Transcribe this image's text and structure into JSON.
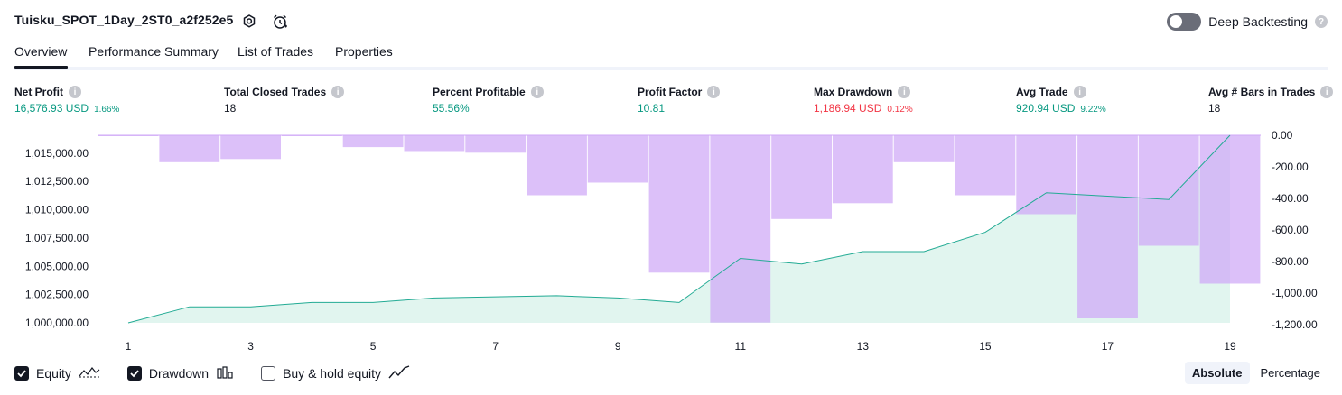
{
  "header": {
    "title": "Tuisku_SPOT_1Day_2ST0_a2f252e5",
    "deep_backtesting_label": "Deep Backtesting",
    "help_mark": "?"
  },
  "tabs": [
    {
      "label": "Overview",
      "active": true
    },
    {
      "label": "Performance Summary",
      "active": false
    },
    {
      "label": "List of Trades",
      "active": false
    },
    {
      "label": "Properties",
      "active": false
    }
  ],
  "metrics": [
    {
      "label": "Net Profit",
      "value": "16,576.93 USD",
      "pct": "1.66%",
      "color": "#089981"
    },
    {
      "label": "Total Closed Trades",
      "value": "18",
      "pct": "",
      "color": "#131722"
    },
    {
      "label": "Percent Profitable",
      "value": "55.56%",
      "pct": "",
      "color": "#089981"
    },
    {
      "label": "Profit Factor",
      "value": "10.81",
      "pct": "",
      "color": "#089981"
    },
    {
      "label": "Max Drawdown",
      "value": "1,186.94 USD",
      "pct": "0.12%",
      "color": "#f23645"
    },
    {
      "label": "Avg Trade",
      "value": "920.94 USD",
      "pct": "9.22%",
      "color": "#089981"
    },
    {
      "label": "Avg # Bars in Trades",
      "value": "18",
      "pct": "",
      "color": "#131722"
    }
  ],
  "info_mark": "i",
  "chart_data": {
    "type": "line",
    "x": [
      1,
      2,
      3,
      4,
      5,
      6,
      7,
      8,
      9,
      10,
      11,
      12,
      13,
      14,
      15,
      16,
      17,
      18,
      19
    ],
    "x_tick_labels": [
      "1",
      "3",
      "5",
      "7",
      "9",
      "11",
      "13",
      "15",
      "17",
      "19"
    ],
    "series": [
      {
        "name": "Equity",
        "axis": "left",
        "type": "area",
        "values": [
          1000000,
          1001420,
          1001420,
          1001800,
          1001800,
          1002200,
          1002300,
          1002400,
          1002200,
          1001800,
          1005700,
          1005200,
          1006300,
          1006300,
          1008000,
          1011500,
          1011200,
          1010900,
          1016577
        ]
      },
      {
        "name": "Drawdown",
        "axis": "right",
        "type": "bar",
        "values": [
          -5,
          -170,
          -150,
          -5,
          -75,
          -100,
          -110,
          -380,
          -300,
          -870,
          -1187,
          -530,
          -430,
          -170,
          -380,
          -500,
          -1160,
          -700,
          -940
        ]
      }
    ],
    "left_axis": {
      "ticks": [
        "1,000,000.00",
        "1,002,500.00",
        "1,005,000.00",
        "1,007,500.00",
        "1,010,000.00",
        "1,012,500.00",
        "1,015,000.00"
      ],
      "min": 1000000,
      "max": 1016577
    },
    "right_axis": {
      "ticks": [
        "0.00",
        "-200.00",
        "-400.00",
        "-600.00",
        "-800.00",
        "-1,000.00",
        "-1,200.00"
      ],
      "min": -1200,
      "max": 0
    },
    "colors": {
      "equity_line": "#22ab94",
      "equity_fill": "#e1f5ef",
      "drawdown": "#cfa8f7"
    }
  },
  "legend": {
    "items": [
      {
        "label": "Equity",
        "checked": true,
        "icon": "equity-icon"
      },
      {
        "label": "Drawdown",
        "checked": true,
        "icon": "drawdown-bars-icon"
      },
      {
        "label": "Buy & hold equity",
        "checked": false,
        "icon": "buy-hold-icon"
      }
    ]
  },
  "modes": {
    "absolute": "Absolute",
    "percentage": "Percentage",
    "active": "absolute"
  }
}
